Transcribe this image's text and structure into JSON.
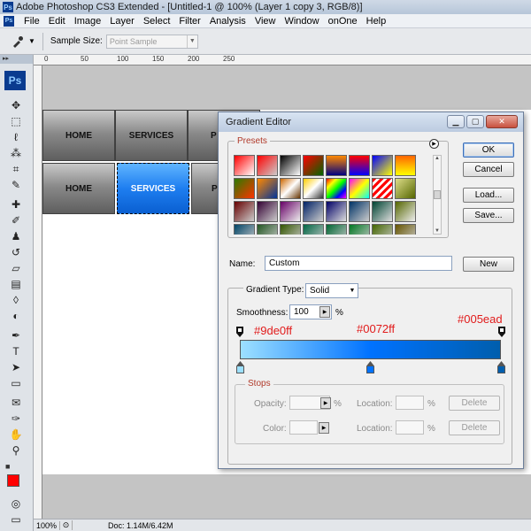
{
  "app": {
    "title": "Adobe Photoshop CS3 Extended - [Untitled-1 @ 100% (Layer 1 copy 3, RGB/8)]",
    "logo": "Ps"
  },
  "menu": [
    "File",
    "Edit",
    "Image",
    "Layer",
    "Select",
    "Filter",
    "Analysis",
    "View",
    "Window",
    "onOne",
    "Help"
  ],
  "options_bar": {
    "sample_size_label": "Sample Size:",
    "sample_size_value": "Point Sample"
  },
  "ruler": {
    "top_numbers": [
      "0",
      "50",
      "100",
      "150",
      "200",
      "250"
    ]
  },
  "canvas": {
    "nav_row1": [
      "HOME",
      "SERVICES",
      "P"
    ],
    "nav_row2": [
      "HOME",
      "SERVICES",
      "P"
    ]
  },
  "status": {
    "zoom": "100%",
    "doc": "Doc: 1.14M/6.42M"
  },
  "dialog": {
    "title": "Gradient Editor",
    "presets_label": "Presets",
    "buttons": {
      "ok": "OK",
      "cancel": "Cancel",
      "load": "Load...",
      "save": "Save...",
      "new": "New",
      "delete1": "Delete",
      "delete2": "Delete"
    },
    "name_label": "Name:",
    "name_value": "Custom",
    "gradient_type_label": "Gradient Type:",
    "gradient_type_value": "Solid",
    "smoothness_label": "Smoothness:",
    "smoothness_value": "100",
    "percent": "%",
    "stops_label": "Stops",
    "opacity_label": "Opacity:",
    "color_label": "Color:",
    "location_label": "Location:",
    "stop_colors": {
      "left": "#9de0ff",
      "middle": "#0072ff",
      "right": "#005ead"
    },
    "annotations": [
      "#9de0ff",
      "#0072ff",
      "#005ead"
    ]
  },
  "colors": {
    "foreground": "#ff0000",
    "nav_active": "#1e7ef0"
  }
}
